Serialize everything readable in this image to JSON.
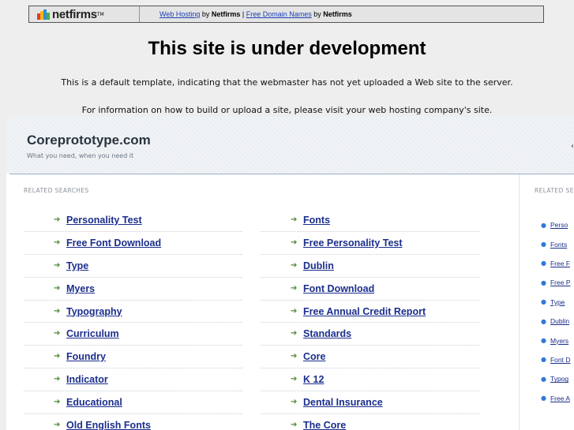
{
  "banner": {
    "logo_text": "netfirms",
    "link1": "Web Hosting",
    "by1": " by ",
    "brand1": "Netfirms",
    "sep": " | ",
    "link2": "Free Domain Names",
    "by2": " by ",
    "brand2": "Netfirms"
  },
  "notice": {
    "title": "This site is under development",
    "line1": "This is a default template, indicating that the webmaster has not yet uploaded a Web site to the server.",
    "line2": "For information on how to build or upload a site, please visit your web hosting company's site."
  },
  "site": {
    "name": "Coreprototype.com",
    "tagline": "What you need, when you need it"
  },
  "main": {
    "label": "RELATED SEARCHES",
    "left": [
      "Personality Test",
      "Free Font Download",
      "Type",
      "Myers",
      "Typography",
      "Curriculum",
      "Foundry",
      "Indicator",
      "Educational",
      "Old English Fonts"
    ],
    "right": [
      "Fonts",
      "Free Personality Test",
      "Dublin",
      "Font Download",
      "Free Annual Credit Report",
      "Standards",
      "Core",
      "K 12",
      "Dental Insurance",
      "The Core"
    ]
  },
  "side": {
    "label": "RELATED SEA",
    "items": [
      "Perso",
      "Fonts",
      "Free F",
      "Free P",
      "Type",
      "Dublin",
      "Myers",
      "Font D",
      "Typog",
      "Free A"
    ]
  },
  "colors": {
    "link": "#1b2e8c",
    "arrow": "#4b8a35",
    "bullet": "#2f7ad8"
  }
}
